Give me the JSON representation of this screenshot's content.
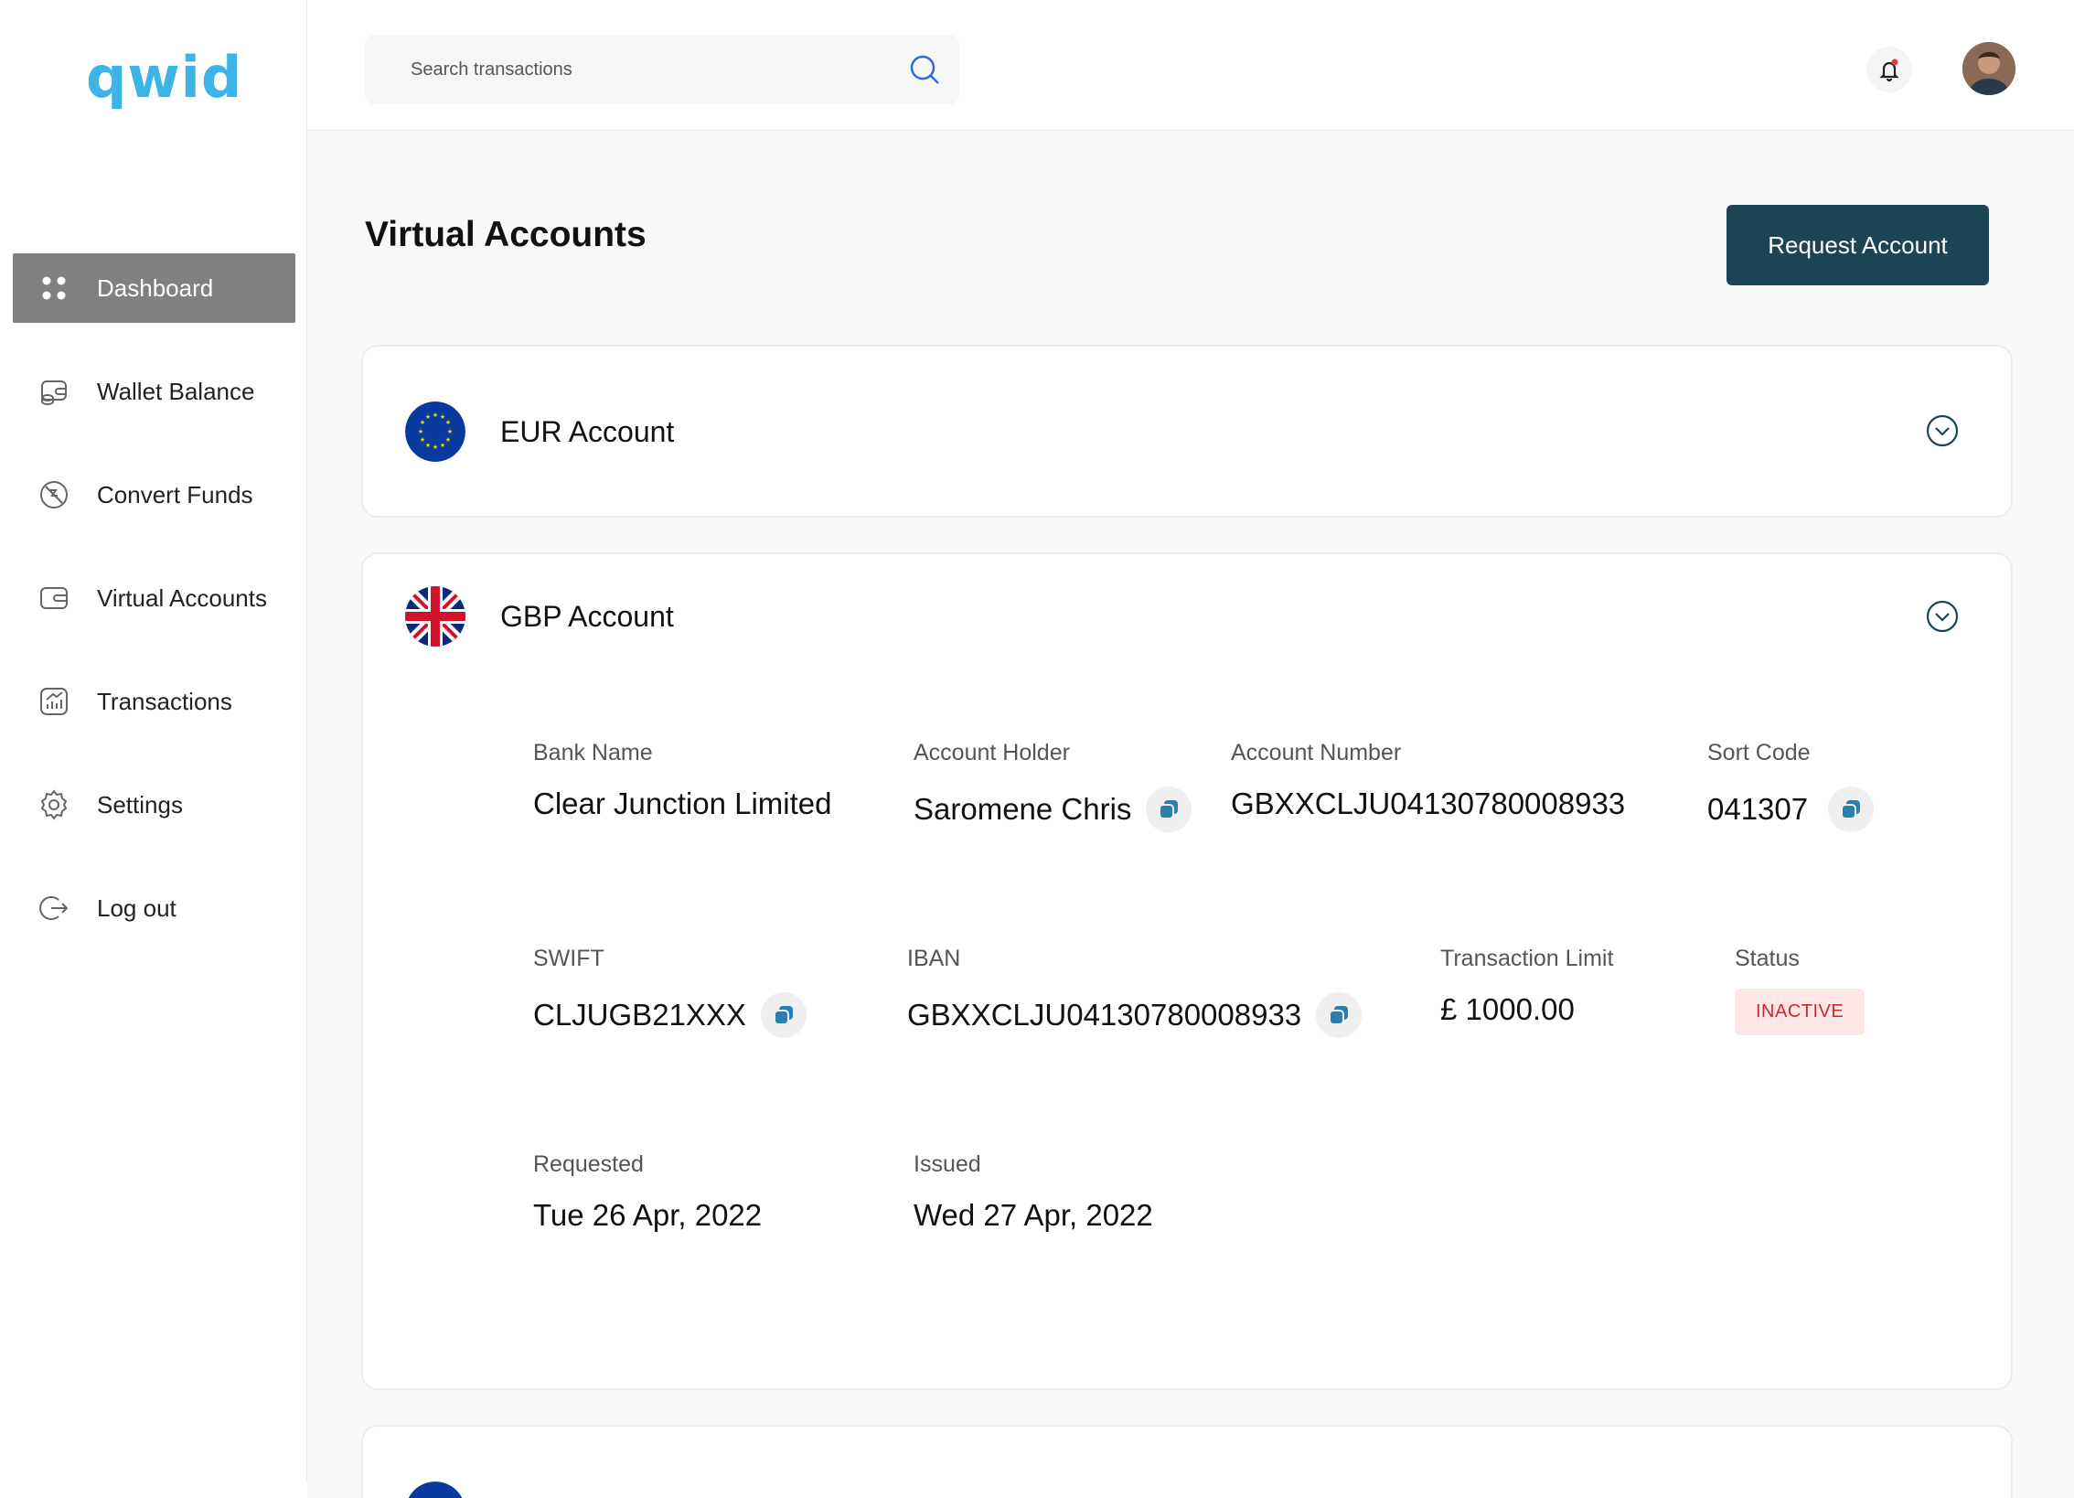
{
  "brand": {
    "logo": "qwid",
    "accent": "#3cb4e6"
  },
  "sidebar": {
    "items": [
      {
        "label": "Dashboard",
        "icon": "grid-dots-icon",
        "active": true
      },
      {
        "label": "Wallet Balance",
        "icon": "wallet-coins-icon",
        "active": false
      },
      {
        "label": "Convert Funds",
        "icon": "convert-icon",
        "active": false
      },
      {
        "label": "Virtual Accounts",
        "icon": "virtual-wallet-icon",
        "active": false
      },
      {
        "label": "Transactions",
        "icon": "chart-icon",
        "active": false
      },
      {
        "label": "Settings",
        "icon": "gear-icon",
        "active": false
      },
      {
        "label": "Log out",
        "icon": "logout-icon",
        "active": false
      }
    ]
  },
  "header": {
    "search_placeholder": "Search transactions"
  },
  "page": {
    "title": "Virtual Accounts",
    "request_button": "Request Account"
  },
  "accounts": {
    "eur": {
      "title": "EUR Account",
      "flag": "eu-flag-icon"
    },
    "gbp": {
      "title": "GBP Account",
      "flag": "uk-flag-icon",
      "fields": {
        "bank_name": {
          "label": "Bank Name",
          "value": "Clear Junction Limited"
        },
        "account_holder": {
          "label": "Account Holder",
          "value": "Saromene Chris"
        },
        "account_number": {
          "label": "Account Number",
          "value": "GBXXCLJU04130780008933"
        },
        "sort_code": {
          "label": "Sort Code",
          "value": "041307"
        },
        "swift": {
          "label": "SWIFT",
          "value": "CLJUGB21XXX"
        },
        "iban": {
          "label": "IBAN",
          "value": "GBXXCLJU04130780008933"
        },
        "transaction_limit": {
          "label": "Transaction Limit",
          "value": "£ 1000.00"
        },
        "status": {
          "label": "Status",
          "value": "INACTIVE",
          "color": "#cc2a2a"
        },
        "requested": {
          "label": "Requested",
          "value": "Tue 26 Apr, 2022"
        },
        "issued": {
          "label": "Issued",
          "value": "Wed 27 Apr, 2022"
        }
      }
    },
    "third": {
      "flag": "eu-flag-icon"
    }
  },
  "colors": {
    "primary_button": "#1b4456",
    "copy_icon": "#2a7fb0",
    "active_nav": "#808080"
  }
}
